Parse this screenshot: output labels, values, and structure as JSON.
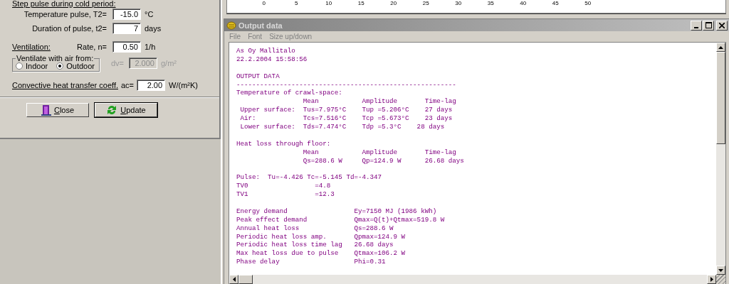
{
  "settings_panel": {
    "section_label": "Step pulse during cold period:",
    "rows": [
      {
        "label": "Temperature pulse, T2=",
        "value": "-15.0",
        "unit": "°C"
      },
      {
        "label": "Duration of pulse, t2=",
        "value": "7",
        "unit": "days"
      }
    ],
    "ventilation": {
      "label": "Ventilation:",
      "rate_label": "Rate, n=",
      "rate_value": "0.50",
      "rate_unit": "1/h",
      "source_group": {
        "title": "Ventilate with air from:",
        "options": [
          {
            "label": "Indoor",
            "selected": false
          },
          {
            "label": "Outdoor",
            "selected": true
          }
        ]
      },
      "dv": {
        "label": "dv=",
        "value": "2.000",
        "unit": "g/m²",
        "disabled": true
      }
    },
    "convective": {
      "label": "Convective heat transfer coeff.",
      "symbol": "ac=",
      "value": "2.00",
      "unit": "W/(m²K)"
    },
    "buttons": [
      {
        "kind": "close",
        "label": "Close"
      },
      {
        "kind": "update",
        "label": "Update"
      }
    ]
  },
  "top_chart": {
    "x_ticks": [
      "0",
      "5",
      "10",
      "15",
      "20",
      "25",
      "30",
      "35",
      "40",
      "45",
      "50"
    ]
  },
  "output_window": {
    "title": "Output data",
    "menu": [
      "File",
      "Font",
      "Size up/down"
    ],
    "blocks": [
      [
        "As Oy Mallitalo",
        "22.2.2004 15:58:56"
      ],
      [
        "OUTPUT DATA",
        "--------------------------------------------------------",
        "Temperature of crawl-space:",
        "                 Mean           Amplitude       Time-lag",
        " Upper surface:  Tus=7.975°C    Tup =5.206°C    27 days",
        " Air:            Tcs=7.516°C    Tcp =5.673°C    23 days",
        " Lower surface:  Tds=7.474°C    Tdp =5.3°C    28 days"
      ],
      [
        "Heat loss through floor:",
        "                 Mean           Amplitude       Time-lag",
        "                 Qs=288.6 W     Qp=124.9 W      26.68 days"
      ],
      [
        "Pulse:  Tu=-4.426 Tc=-5.145 Td=-4.347",
        "TV0                 =4.8",
        "TV1                 =12.3"
      ],
      [
        "Energy demand                 Ey=7150 MJ (1986 kWh)",
        "Peak effect demand            Qmax=Q(t)+Qtmax=519.8 W",
        "Annual heat loss              Qs=288.6 W",
        "Periodic heat loss amp.       Qpmax=124.9 W",
        "Periodic heat loss time lag   26.68 days",
        "Max heat loss due to pulse    Qtmax=106.2 W",
        "Phase delay                   Phi=0.31"
      ]
    ]
  }
}
